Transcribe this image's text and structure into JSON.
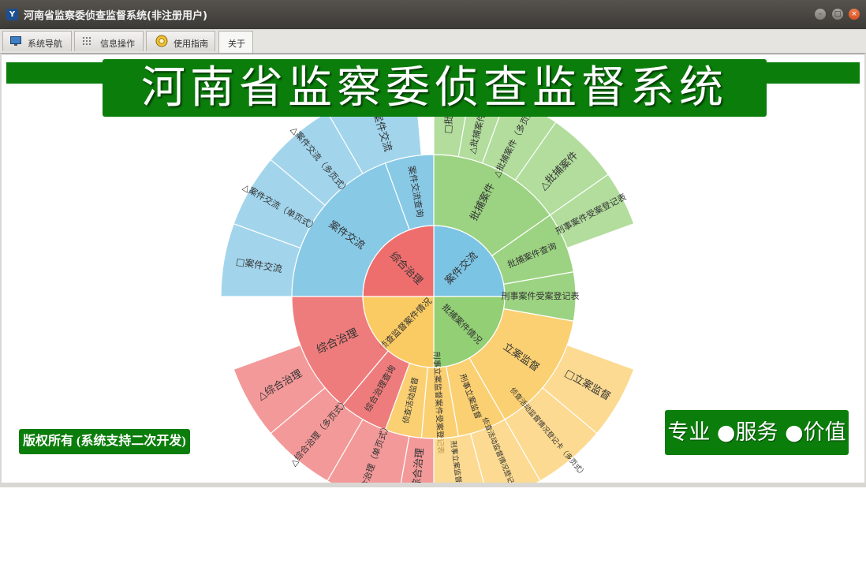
{
  "window": {
    "title": "河南省监察委侦查监督系统(非注册用户)",
    "app_icon": "app-logo-icon",
    "controls": [
      "minimize-icon",
      "maximize-icon",
      "close-icon"
    ]
  },
  "tabs": [
    {
      "label": "系统导航",
      "icon": "monitor-icon"
    },
    {
      "label": "信息操作",
      "icon": "grid-icon"
    },
    {
      "label": "使用指南",
      "icon": "guide-icon"
    },
    {
      "label": "关于",
      "icon": ""
    }
  ],
  "banner": {
    "title": "河南省监察委侦查监督系统"
  },
  "copyright": "版权所有 (系统支持二次开发)",
  "slogan": "专业 ●服务 ●价值",
  "colors": {
    "brand_green": "#0b7d0b",
    "blue": "#7cc4e4",
    "green": "#92cf75",
    "orange": "#fbcb63",
    "red": "#ee6e6e"
  },
  "chart_data": {
    "type": "sunburst",
    "rings": [
      [
        "案件交流",
        "批捕案件情况",
        "侦查监督案件情况",
        "综合治理"
      ],
      [
        "案件交流",
        "案件交流查询",
        "批捕案件",
        "批捕案件查询",
        "刑事案件受案登记表",
        "立案监督",
        "刑事立案监督",
        "刑事立案监督案件受案登记表",
        "侦查活动监督",
        "综合治理查询",
        "综合治理"
      ],
      [
        "□案件交流",
        "△案件交流（单页式）",
        "△案件交流（多页式）",
        "□案件交流",
        "□批捕",
        "△批捕案件（单",
        "△批捕案件（多页式）",
        "△批捕案件",
        "刑事案件受案登记表",
        "□立案监督",
        "侦查活动监督情况登记卡（多页式）",
        "侦查活动监督情况登记卡（单",
        "刑事立案监督案件受",
        "□综合治理",
        "△综合治理（单页式）",
        "△综合治理（多页式）",
        "△综合治理"
      ]
    ]
  }
}
